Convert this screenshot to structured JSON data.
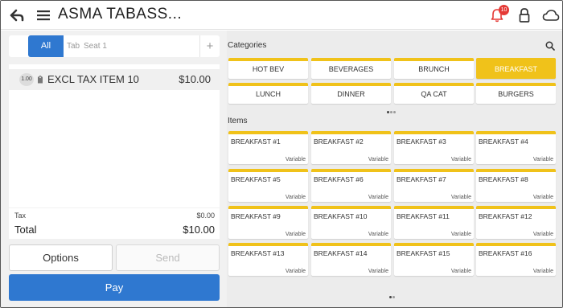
{
  "header": {
    "title": "ASMA TABASS...",
    "notification_count": "10"
  },
  "order_tabs": {
    "all": "All",
    "tab": "Tab",
    "seat": "Seat 1",
    "add": "+"
  },
  "order": {
    "items": [
      {
        "qty": "1.00",
        "name": "EXCL TAX ITEM 10",
        "price": "$10.00"
      }
    ],
    "tax_label": "Tax",
    "tax_value": "$0.00",
    "total_label": "Total",
    "total_value": "$10.00"
  },
  "actions": {
    "options": "Options",
    "send": "Send",
    "pay": "Pay"
  },
  "categories": {
    "label": "Categories",
    "list": [
      "HOT BEV",
      "BEVERAGES",
      "BRUNCH",
      "BREAKFAST",
      "LUNCH",
      "DINNER",
      "QA CAT",
      "BURGERS"
    ],
    "active": "BREAKFAST"
  },
  "items_section": {
    "label": "Items",
    "list": [
      {
        "name": "BREAKFAST #1",
        "price_type": "Variable"
      },
      {
        "name": "BREAKFAST #2",
        "price_type": "Variable"
      },
      {
        "name": "BREAKFAST #3",
        "price_type": "Variable"
      },
      {
        "name": "BREAKFAST #4",
        "price_type": "Variable"
      },
      {
        "name": "BREAKFAST #5",
        "price_type": "Variable"
      },
      {
        "name": "BREAKFAST #6",
        "price_type": "Variable"
      },
      {
        "name": "BREAKFAST #7",
        "price_type": "Variable"
      },
      {
        "name": "BREAKFAST #8",
        "price_type": "Variable"
      },
      {
        "name": "BREAKFAST #9",
        "price_type": "Variable"
      },
      {
        "name": "BREAKFAST #10",
        "price_type": "Variable"
      },
      {
        "name": "BREAKFAST #11",
        "price_type": "Variable"
      },
      {
        "name": "BREAKFAST #12",
        "price_type": "Variable"
      },
      {
        "name": "BREAKFAST #13",
        "price_type": "Variable"
      },
      {
        "name": "BREAKFAST #14",
        "price_type": "Variable"
      },
      {
        "name": "BREAKFAST #15",
        "price_type": "Variable"
      },
      {
        "name": "BREAKFAST #16",
        "price_type": "Variable"
      }
    ]
  },
  "icons": {
    "back": "back-arrow-icon",
    "menu": "hamburger-menu-icon",
    "notifications": "bell-icon",
    "lock": "lock-icon",
    "sync": "cloud-icon",
    "search": "search-icon",
    "item_tag": "tag-icon"
  },
  "colors": {
    "primary_blue": "#2f78d0",
    "accent_yellow": "#f0c21a",
    "badge_red": "#e53935"
  }
}
